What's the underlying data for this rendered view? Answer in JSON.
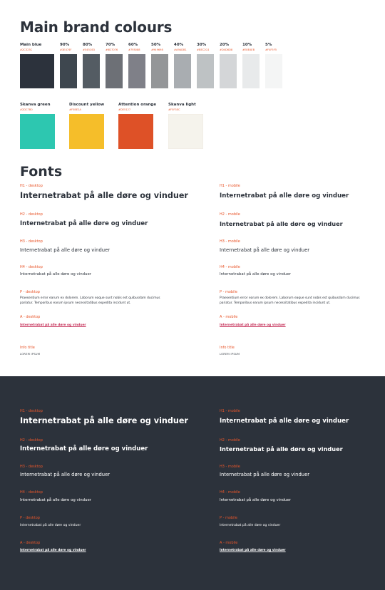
{
  "brand": {
    "title": "Main brand colours",
    "swatches": [
      {
        "label": "Main blue",
        "hex": "#2C323C",
        "color": "#2c323c"
      },
      {
        "label": "90%",
        "hex": "#3E474F",
        "color": "#3e474f"
      },
      {
        "label": "80%",
        "hex": "#545C63",
        "color": "#545c63"
      },
      {
        "label": "70%",
        "hex": "#6D7076",
        "color": "#6d7076"
      },
      {
        "label": "60%",
        "hex": "#7F8088",
        "color": "#7f8088"
      },
      {
        "label": "50%",
        "hex": "#949698",
        "color": "#949698"
      },
      {
        "label": "40%",
        "hex": "#A9ADB1",
        "color": "#a9adb1"
      },
      {
        "label": "30%",
        "hex": "#BEC2C4",
        "color": "#bec2c4"
      },
      {
        "label": "20%",
        "hex": "#D4D6D8",
        "color": "#d4d6d8"
      },
      {
        "label": "10%",
        "hex": "#E8EAEB",
        "color": "#e8eaeb"
      },
      {
        "label": "5%",
        "hex": "#F4F5F5",
        "color": "#f4f5f5"
      }
    ],
    "accents": [
      {
        "label": "Skanva green",
        "hex": "#2DC7B0",
        "color": "#2dc7b0"
      },
      {
        "label": "Discount yellow",
        "hex": "#F5BE2A",
        "color": "#f5be2a"
      },
      {
        "label": "Attention orange",
        "hex": "#DE5127",
        "color": "#de5127"
      },
      {
        "label": "Skanva light",
        "hex": "#F5F3EC",
        "color": "#f5f3ec"
      }
    ]
  },
  "fonts": {
    "title": "Fonts",
    "sample_text": "Internetrabat på alle døre og vinduer",
    "paragraph_text": "Praesentium error earum ex dolorem. Laborum eaque sunt nobis est quibusdam ducimus pariatur. Temporibus earum ipsum necessitatibus expedita incidunt ut.",
    "info_text": "LOREM IPSUM",
    "labels": {
      "h1_desktop": "H1 - desktop",
      "h1_mobile": "H1 - mobile",
      "h2_desktop": "H2 - desktop",
      "h2_mobile": "H2 - mobile",
      "h3_desktop": "H3 - desktop",
      "h3_mobile": "H3 - mobile",
      "h4_desktop": "H4 - desktop",
      "h4_mobile": "H4 - mobile",
      "p_desktop": "P - desktop",
      "p_mobile": "P - mobile",
      "a_desktop": "A - desktop",
      "a_mobile": "A - mobile",
      "info_title": "Info title"
    }
  },
  "colors": {
    "dark_background": "#2C323B",
    "label_orange": "#E8562B",
    "link_pink": "#C8385F"
  }
}
